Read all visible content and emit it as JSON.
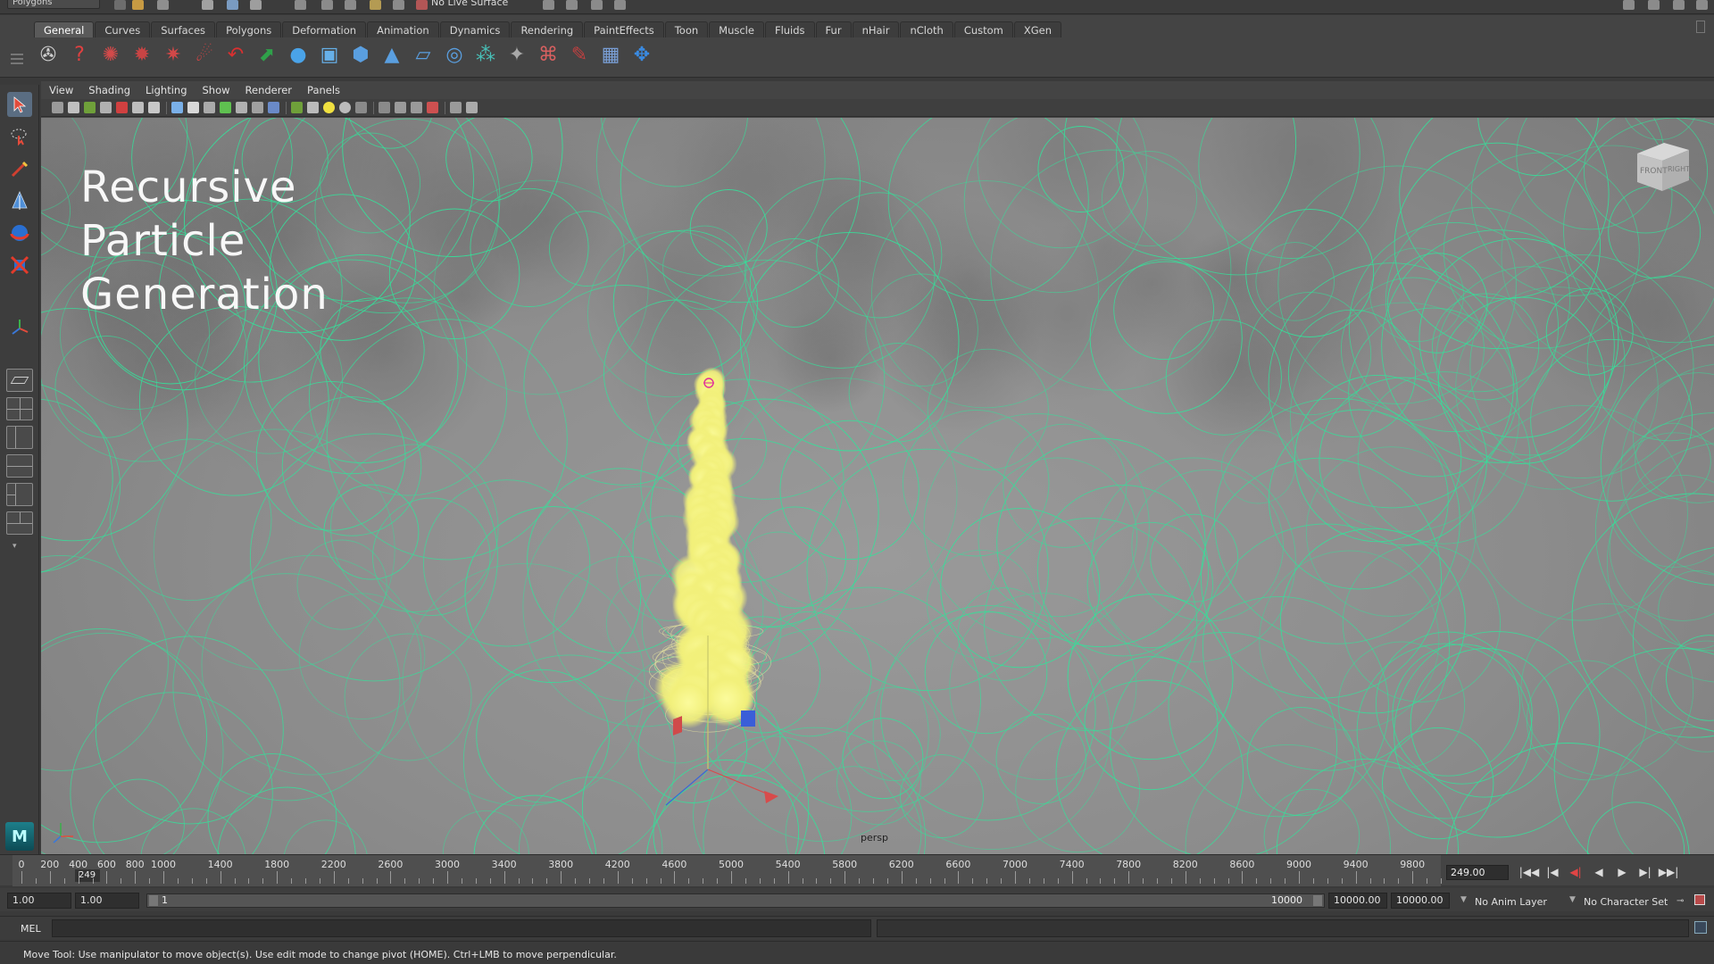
{
  "status_line": {
    "mode": "Polygons",
    "live_surface": "No Live Surface"
  },
  "shelf": {
    "tabs": [
      "General",
      "Curves",
      "Surfaces",
      "Polygons",
      "Deformation",
      "Animation",
      "Dynamics",
      "Rendering",
      "PaintEffects",
      "Toon",
      "Muscle",
      "Fluids",
      "Fur",
      "nHair",
      "nCloth",
      "Custom",
      "XGen"
    ],
    "active_tab": "General",
    "icons": [
      "film-reel-icon",
      "help-icon",
      "hypershade-icon",
      "render-view-icon",
      "render-current-icon",
      "ipr-render-icon",
      "lasso-icon",
      "move-icon",
      "sphere-icon",
      "cube-icon",
      "cylinder-icon",
      "cone-icon",
      "plane-icon",
      "torus-icon",
      "particle-icon",
      "emitter-icon",
      "field-icon",
      "paint-icon",
      "uv-icon",
      "transform-icon"
    ]
  },
  "panel": {
    "menus": [
      "View",
      "Shading",
      "Lighting",
      "Show",
      "Renderer",
      "Panels"
    ]
  },
  "viewport": {
    "overlay_title": "Recursive\nParticle\nGeneration",
    "camera": "persp",
    "view_cube_front": "FRONT",
    "view_cube_right": "RIGHT",
    "particle_color": "#f6f58a",
    "wire_color": "#35e09a"
  },
  "time_slider": {
    "ticks": [
      "0",
      "200",
      "400",
      "600",
      "800",
      "1000",
      "1400",
      "1800",
      "2200",
      "2600",
      "3000",
      "3400",
      "3800",
      "4200",
      "4600",
      "5000",
      "5400",
      "5800",
      "6200",
      "6600",
      "7000",
      "7400",
      "7800",
      "8200",
      "8600",
      "9000",
      "9400",
      "9800"
    ],
    "playhead_frame": "249",
    "current_time": "249.00",
    "playback_buttons": [
      "|◀◀",
      "|◀",
      "◀|",
      "◀",
      "▶",
      "▶|",
      "▶▶|"
    ]
  },
  "range_slider": {
    "start_time": "1.00",
    "range_start": "1.00",
    "bar_start": "1",
    "bar_end": "10000",
    "range_end": "10000.00",
    "end_time": "10000.00",
    "anim_layer": "No Anim Layer",
    "character_set": "No Character Set"
  },
  "command_line": {
    "label": "MEL"
  },
  "help_line": {
    "text": "Move Tool: Use manipulator to move object(s). Use edit mode to change pivot (HOME).  Ctrl+LMB to move perpendicular."
  }
}
